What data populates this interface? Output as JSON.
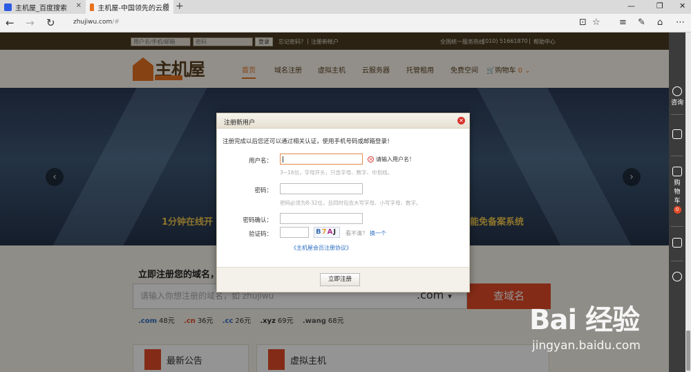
{
  "browser": {
    "tabs": [
      {
        "label": "主机屋_百度搜索",
        "close": "✕"
      },
      {
        "label": "主机屋-中国领先的云服",
        "close": "✕"
      }
    ],
    "new_tab": "+",
    "win_controls": [
      "—",
      "❐",
      "✕"
    ],
    "nav": {
      "back": "←",
      "forward": "→",
      "reload": "↻"
    },
    "url_host": "zhujiwu.com",
    "url_path": "/#",
    "tools": [
      "⊡",
      "☆",
      "≡",
      "✎",
      "⌂",
      "⋯"
    ]
  },
  "topbar": {
    "username_placeholder": "用户名/手机/邮箱",
    "password_placeholder": "密码",
    "login": "登录",
    "forgot": "忘记密码？",
    "sep": "|",
    "register": "注册新帐户",
    "hotline_label": "全国统一服务热线",
    "hotline": "(010) 51661870",
    "help": "帮助中心"
  },
  "header": {
    "logo_name": "主机屋",
    "menu": [
      "首页",
      "域名注册",
      "虚拟主机",
      "云服务器",
      "托管租用",
      "免费空间"
    ],
    "cart": "购物车",
    "cart_count": "0",
    "cart_caret": "⌄"
  },
  "banner": {
    "slogan_left": "1分钟在线开",
    "slogan_right": "能免备案系统",
    "prev": "‹",
    "next": "›"
  },
  "domain": {
    "title": "立即注册您的域名，开",
    "placeholder": "请输入你想注册的域名，如 zhujiwu",
    "suffix": ".com",
    "caret": "▾",
    "search": "查域名",
    "prices": [
      {
        "ext": ".com",
        "price": "48元"
      },
      {
        "ext": ".cn",
        "price": "36元"
      },
      {
        "ext": ".cc",
        "price": "26元"
      },
      {
        "ext": ".xyz",
        "price": "69元"
      },
      {
        "ext": ".wang",
        "price": "68元"
      }
    ]
  },
  "cards": [
    "最新公告",
    "虚拟主机"
  ],
  "modal": {
    "title": "注册新用户",
    "close": "✕",
    "intro": "注册完成以后您还可以通过相关认证，使用手机号码或邮箱登录！",
    "username_label": "用户名：",
    "username_hint": "3~16位，字母开头，只含字母、数字、中划线。",
    "username_error": "请输入用户名！",
    "error_icon": "✕",
    "password_label": "密码：",
    "password_hint": "密码必须为8-32位，且同时包含大写字母、小写字母、数字。",
    "confirm_label": "密码确认：",
    "captcha_label": "验证码：",
    "captcha_chars": [
      "B",
      "7",
      "A",
      "J"
    ],
    "captcha_unclear": "看不清？",
    "captcha_refresh": "换一个",
    "agreement": "《主机屋会员注册协议》",
    "submit": "立即注册"
  },
  "sidebar": {
    "consult": "咨询",
    "cart_chars": [
      "购",
      "物",
      "车"
    ],
    "cart_count": "0"
  },
  "watermark": {
    "logo": "Bai 经验",
    "url": "jingyan.baidu.com"
  }
}
